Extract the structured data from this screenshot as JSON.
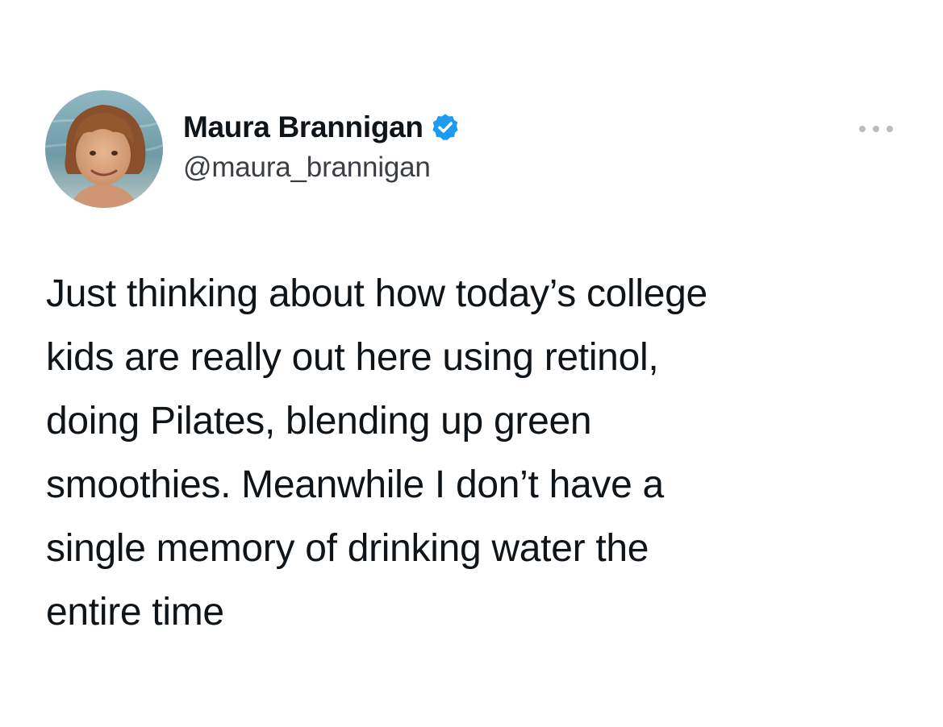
{
  "author": {
    "display_name": "Maura Brannigan",
    "handle": "@maura_brannigan",
    "verified": true,
    "avatar_icon": "profile-photo-avatar",
    "verified_icon": "verified-checkmark-icon",
    "verified_color": "#1d9bf0"
  },
  "menu": {
    "icon": "more-options-ellipsis-icon",
    "color": "#b9bec4"
  },
  "tweet": {
    "lines": [
      "Just thinking about how today’s college",
      "kids are really out here using retinol,",
      "doing Pilates, blending up green",
      "smoothies. Meanwhile I don’t have a",
      "single memory of drinking water the",
      "entire time"
    ]
  }
}
